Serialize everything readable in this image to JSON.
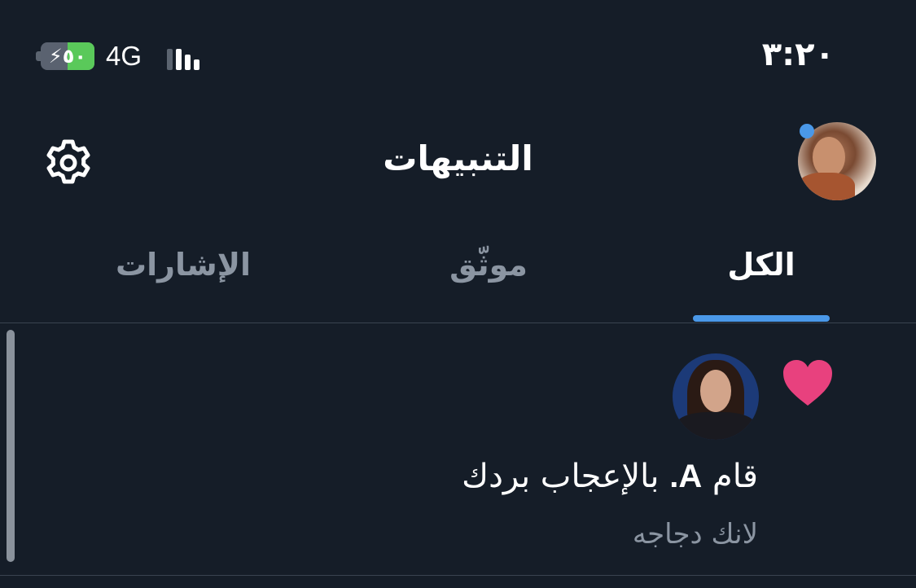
{
  "status_bar": {
    "time": "٣:٢٠",
    "battery_level": "٥٠",
    "battery_percent": 50,
    "network": "4G",
    "signal_bars_active": 3,
    "battery_color": "#5ac95a"
  },
  "header": {
    "title": "التنبيهات",
    "avatar_icon": "profile-avatar",
    "settings_icon": "gear-icon",
    "has_unread_dot": true
  },
  "tabs": [
    {
      "label": "الكل",
      "active": true
    },
    {
      "label": "موثّق",
      "active": false
    },
    {
      "label": "الإشارات",
      "active": false
    }
  ],
  "accent_color": "#4a98e8",
  "notifications": [
    {
      "type_icon": "heart-icon",
      "type_color": "#e8417e",
      "actor_prefix": "قام",
      "actor_name": "A.",
      "action_text": "بالإعجاب بردك",
      "preview": "لانك دجاجه"
    }
  ]
}
